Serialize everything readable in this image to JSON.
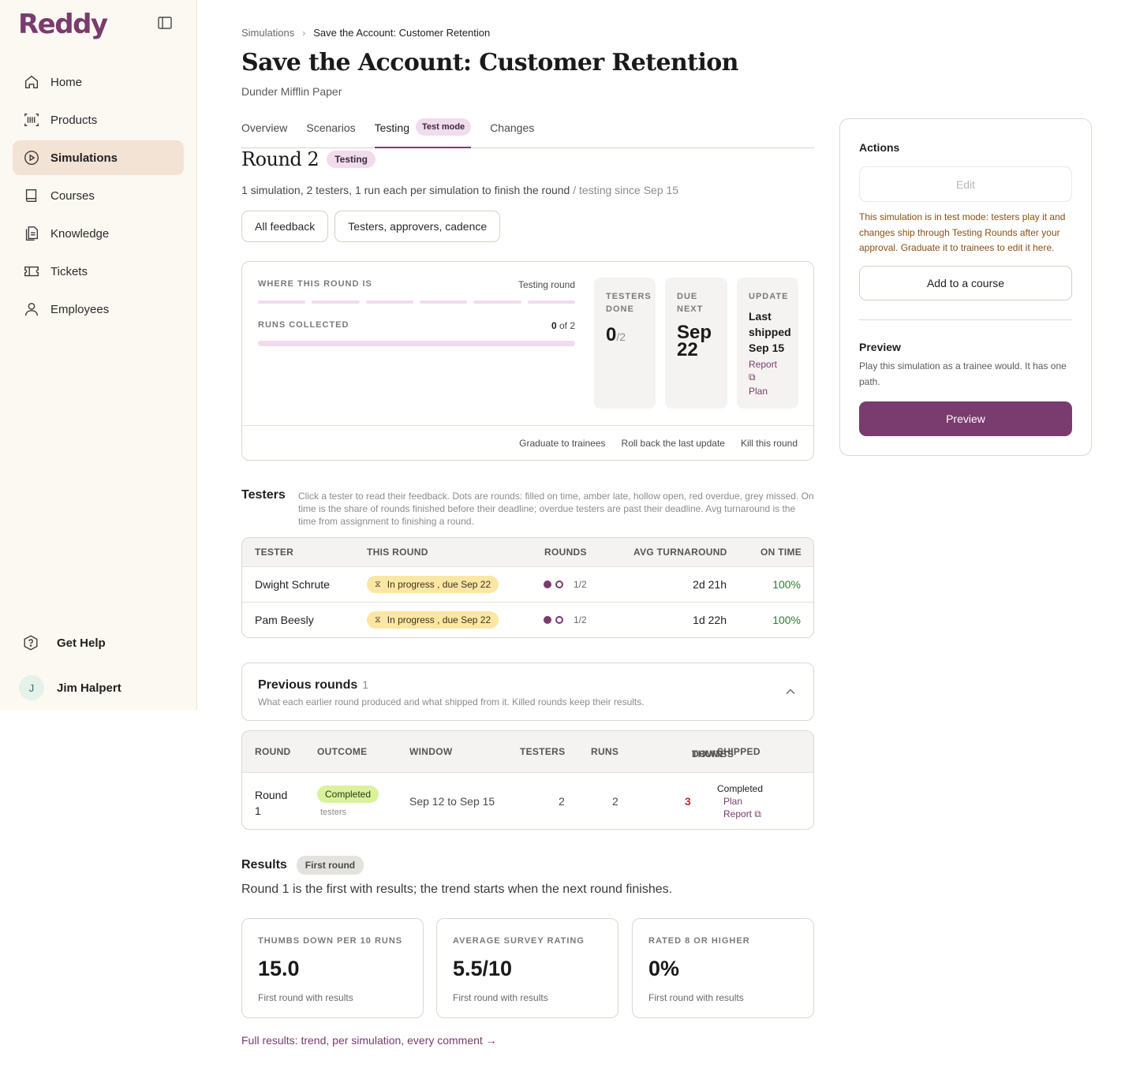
{
  "brand": {
    "name": "Reddy",
    "color": "#7a3b6e"
  },
  "sidebar": {
    "items": [
      {
        "label": "Home",
        "icon": "home-icon"
      },
      {
        "label": "Products",
        "icon": "barcode-icon"
      },
      {
        "label": "Simulations",
        "icon": "play-circle-icon",
        "active": true
      },
      {
        "label": "Courses",
        "icon": "book-icon"
      },
      {
        "label": "Knowledge",
        "icon": "document-icon"
      },
      {
        "label": "Tickets",
        "icon": "ticket-icon"
      },
      {
        "label": "Employees",
        "icon": "user-icon"
      }
    ],
    "help_label": "Get Help",
    "user": {
      "initial": "J",
      "name": "Jim Halpert"
    }
  },
  "breadcrumb": {
    "parent": "Simulations",
    "current": "Save the Account: Customer Retention"
  },
  "page": {
    "title": "Save the Account: Customer Retention",
    "subtitle": "Dunder Mifflin Paper"
  },
  "tabs": [
    {
      "label": "Overview"
    },
    {
      "label": "Scenarios"
    },
    {
      "label": "Testing",
      "active": true,
      "badge": "Test mode"
    },
    {
      "label": "Changes"
    }
  ],
  "round": {
    "title": "Round 2",
    "badge": "Testing",
    "description": "1 simulation, 2 testers, 1 run each per simulation to finish the round",
    "since": " / testing since Sep 15",
    "buttons": {
      "feedback": "All feedback",
      "settings": "Testers, approvers, cadence"
    }
  },
  "status": {
    "where_label": "WHERE THIS ROUND IS",
    "where_value": "Testing round",
    "runs_label": "RUNS COLLECTED",
    "runs_done": "0",
    "runs_total": " of 2",
    "runs_progress": 0,
    "testers_label_1": "TESTERS",
    "testers_label_2": "DONE",
    "testers_done": "0",
    "testers_total": "/2",
    "due_label_1": "DUE",
    "due_label_2": "NEXT",
    "due_month": "Sep",
    "due_day": "22",
    "update_label": "UPDATE",
    "update_line1": "Last",
    "update_line2": "shipped",
    "update_line3": "Sep 15",
    "report_link": "Report",
    "plan_link": "Plan",
    "footer": {
      "graduate": "Graduate to trainees",
      "rollback": "Roll back the last update",
      "kill": "Kill this round"
    }
  },
  "testers": {
    "title": "Testers",
    "description": "Click a tester to read their feedback. Dots are rounds: filled on time, amber late, hollow open, red overdue, grey missed. On time is the share of rounds finished before their deadline; overdue testers are past their deadline. Avg turnaround is the time from assignment to finishing a round.",
    "columns": {
      "tester": "TESTER",
      "this_round": "THIS ROUND",
      "rounds": "ROUNDS",
      "avg": "AVG TURNAROUND",
      "on_time": "ON TIME"
    },
    "rows": [
      {
        "name": "Dwight Schrute",
        "status": "In progress , due Sep 22",
        "rounds": "1/2",
        "avg": "2d 21h",
        "on_time": "100%"
      },
      {
        "name": "Pam Beesly",
        "status": "In progress , due Sep 22",
        "rounds": "1/2",
        "avg": "1d 22h",
        "on_time": "100%"
      }
    ]
  },
  "previous": {
    "title": "Previous rounds",
    "count": "1",
    "description": "What each earlier round produced and what shipped from it. Killed rounds keep their results.",
    "columns": {
      "round": "ROUND",
      "outcome": "OUTCOME",
      "window": "WINDOW",
      "testers": "TESTERS",
      "runs": "RUNS",
      "thumbs_1": "THUMBS",
      "thumbs_2": "DOWN",
      "shipped": "SHIPPED"
    },
    "rows": [
      {
        "round_1": "Round",
        "round_2": "1",
        "outcome": "Completed",
        "outcome_sub": "testers",
        "window": "Sep 12 to Sep 15",
        "testers": "2",
        "runs": "2",
        "thumbs_down": "3",
        "shipped": "Completed",
        "plan": "Plan",
        "report": "Report"
      }
    ]
  },
  "results": {
    "title": "Results",
    "badge": "First round",
    "description": "Round 1 is the first with results; the trend starts when the next round finishes.",
    "metrics": [
      {
        "label": "THUMBS DOWN PER 10 RUNS",
        "value": "15.0",
        "note": "First round with results"
      },
      {
        "label": "AVERAGE SURVEY RATING",
        "value": "5.5/10",
        "note": "First round with results"
      },
      {
        "label": "RATED 8 OR HIGHER",
        "value": "0%",
        "note": "First round with results"
      }
    ],
    "full_link": "Full results: trend, per simulation, every comment",
    "arrow": "→"
  },
  "actions": {
    "title": "Actions",
    "edit": "Edit",
    "test_note": "This simulation is in test mode: testers play it and changes ship through Testing Rounds after your approval. Graduate it to trainees to edit it here.",
    "add_course": "Add to a course",
    "preview_title": "Preview",
    "preview_desc": "Play this simulation as a trainee would. It has one path.",
    "preview_button": "Preview"
  }
}
